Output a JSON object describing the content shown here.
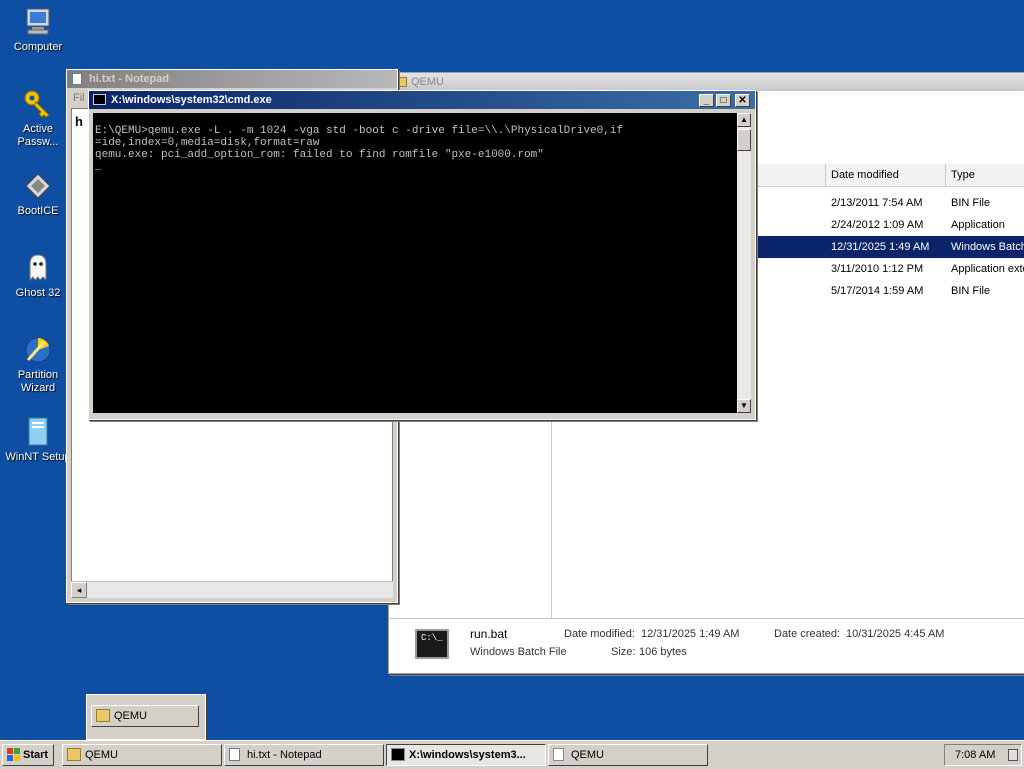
{
  "desktop": {
    "icons": [
      {
        "label": "Computer",
        "icon": "computer-icon"
      },
      {
        "label": "Active Passw...",
        "icon": "key-icon"
      },
      {
        "label": "BootICE",
        "icon": "bootice-icon"
      },
      {
        "label": "Ghost 32",
        "icon": "ghost-icon"
      },
      {
        "label": "Partition Wizard",
        "icon": "partition-wizard-icon"
      },
      {
        "label": "WinNT Setup",
        "icon": "winnt-setup-icon"
      }
    ]
  },
  "notepad": {
    "title": "hi.txt - Notepad",
    "menu_partial": "Fil",
    "content": "h"
  },
  "explorer": {
    "title": "QEMU",
    "columns": {
      "date": "Date modified",
      "type": "Type"
    },
    "rows": [
      {
        "date": "2/13/2011 7:54 AM",
        "type": "BIN File",
        "selected": false
      },
      {
        "date": "2/24/2012 1:09 AM",
        "type": "Application",
        "selected": false
      },
      {
        "date": "12/31/2025 1:49 AM",
        "type": "Windows Batch",
        "selected": true
      },
      {
        "date": "3/11/2010 1:12 PM",
        "type": "Application exte",
        "selected": false
      },
      {
        "date": "5/17/2014 1:59 AM",
        "type": "BIN File",
        "selected": false
      }
    ],
    "details": {
      "name": "run.bat",
      "kind": "Windows Batch File",
      "modified_label": "Date modified:",
      "modified_value": "12/31/2025 1:49 AM",
      "created_label": "Date created:",
      "created_value": "10/31/2025 4:45 AM",
      "size_label": "Size:",
      "size_value": "106 bytes"
    }
  },
  "cmd": {
    "title": "X:\\windows\\system32\\cmd.exe",
    "output": "E:\\QEMU>qemu.exe -L . -m 1024 -vga std -boot c -drive file=\\\\.\\PhysicalDrive0,if\n=ide,index=0,media=disk,format=raw\nqemu.exe: pci_add_option_rom: failed to find romfile \"pxe-e1000.rom\"\n_"
  },
  "taskbar": {
    "start_label": "Start",
    "buttons": [
      {
        "label": "QEMU",
        "pressed": false
      },
      {
        "label": "hi.txt - Notepad",
        "pressed": false
      },
      {
        "label": "X:\\windows\\system3...",
        "pressed": true
      },
      {
        "label": "QEMU",
        "pressed": false
      }
    ],
    "clock": "7:08 AM",
    "popup_label": "QEMU"
  }
}
